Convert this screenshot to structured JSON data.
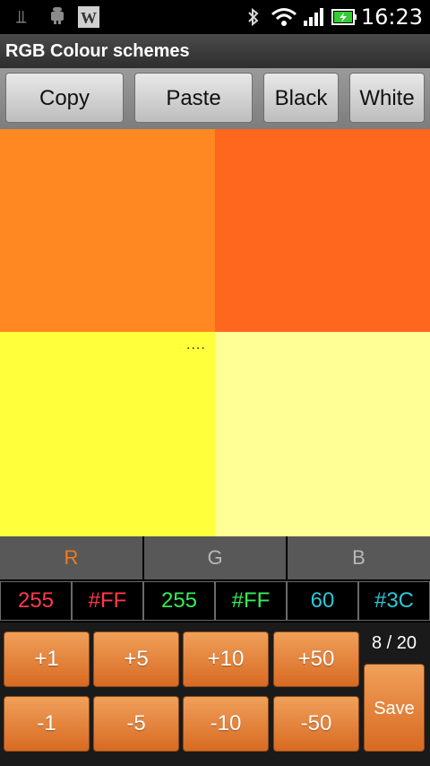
{
  "status_bar": {
    "time": "16:23",
    "notification_icons": [
      "usb-icon",
      "android-icon",
      "w-app-icon"
    ],
    "system_icons": [
      "bluetooth-icon",
      "wifi-icon",
      "signal-icon",
      "battery-icon"
    ]
  },
  "app": {
    "title": "RGB Colour schemes"
  },
  "toolbar": {
    "copy": "Copy",
    "paste": "Paste",
    "black": "Black",
    "white": "White"
  },
  "swatches": [
    {
      "id": "top-left",
      "color": "#ff8822"
    },
    {
      "id": "top-right",
      "color": "#ff661e"
    },
    {
      "id": "bottom-left",
      "color": "#ffff3c"
    },
    {
      "id": "bottom-right",
      "color": "#ffff96"
    }
  ],
  "swatch_marker": "....",
  "channels": [
    {
      "label": "R",
      "label_color": "#f07c1e",
      "dec": "255",
      "hex": "#FF",
      "value_color": "#ff3a4a"
    },
    {
      "label": "G",
      "label_color": "#b8b8b8",
      "dec": "255",
      "hex": "#FF",
      "value_color": "#33ee55"
    },
    {
      "label": "B",
      "label_color": "#b8b8b8",
      "dec": "60",
      "hex": "#3C",
      "value_color": "#2ec6d6"
    }
  ],
  "adjust": {
    "plus": [
      "+1",
      "+5",
      "+10",
      "+50"
    ],
    "minus": [
      "-1",
      "-5",
      "-10",
      "-50"
    ]
  },
  "counter": "8 / 20",
  "save": "Save"
}
